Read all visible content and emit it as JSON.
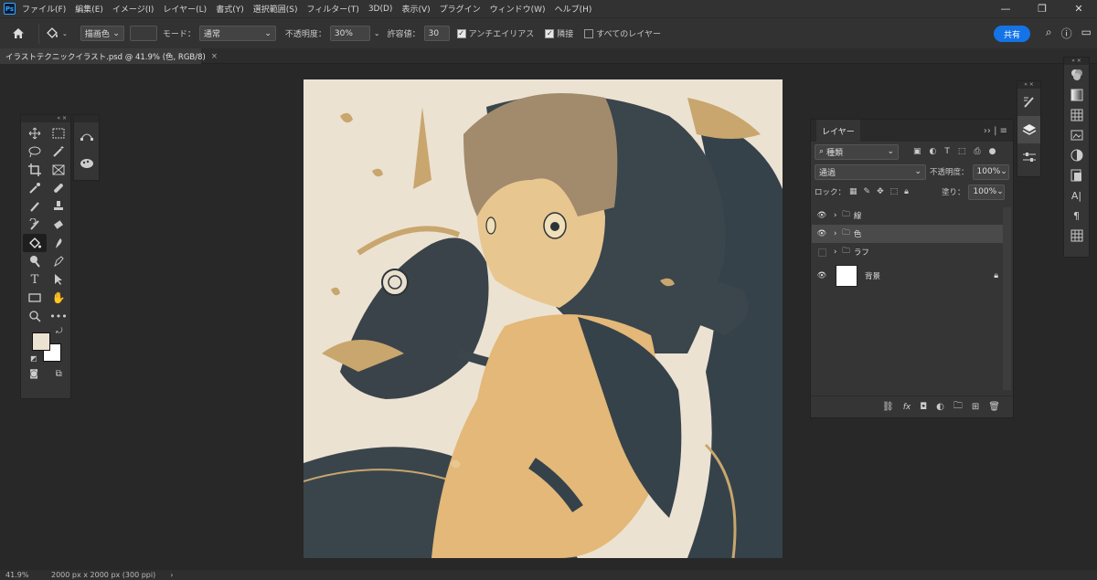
{
  "menubar": {
    "logo": "Ps",
    "items": [
      "ファイル(F)",
      "編集(E)",
      "イメージ(I)",
      "レイヤー(L)",
      "書式(Y)",
      "選択範囲(S)",
      "フィルター(T)",
      "3D(D)",
      "表示(V)",
      "プラグイン",
      "ウィンドウ(W)",
      "ヘルプ(H)"
    ]
  },
  "options": {
    "brush_mode": "描画色",
    "mode_label": "モード：",
    "mode_value": "通常",
    "opacity_label": "不透明度：",
    "opacity_value": "30%",
    "tolerance_label": "許容値：",
    "tolerance_value": "30",
    "antialias_label": "アンチエイリアス",
    "contiguous_label": "隣接",
    "all_layers_label": "すべてのレイヤー",
    "share_label": "共有"
  },
  "document_tab": {
    "title": "イラストテクニックイラスト.psd @ 41.9% (色, RGB/8)",
    "close": "×"
  },
  "layers_panel": {
    "tab_label": "レイヤー",
    "filter_value": "種類",
    "blend_mode": "通過",
    "opacity_label": "不透明度：",
    "opacity_value": "100%",
    "lock_label": "ロック：",
    "fill_label": "塗り：",
    "fill_value": "100%",
    "layers": [
      {
        "name": "線",
        "visible": true,
        "type": "group"
      },
      {
        "name": "色",
        "visible": true,
        "type": "group",
        "selected": true
      },
      {
        "name": "ラフ",
        "visible": false,
        "type": "group"
      },
      {
        "name": "背景",
        "visible": true,
        "type": "background",
        "locked": true
      }
    ]
  },
  "colors": {
    "foreground": "#ece2d2",
    "background": "#ffffff",
    "accent": "#1473e6"
  },
  "status": {
    "zoom": "41.9%",
    "doc_info": "2000 px x 2000 px (300 ppi)",
    "arrow": "›"
  }
}
